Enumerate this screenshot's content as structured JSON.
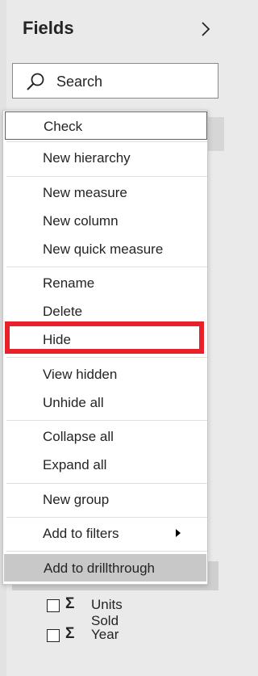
{
  "pane": {
    "title": "Fields",
    "collapse_icon": "chevron-right-icon",
    "search_placeholder": "Search",
    "search_icon": "search-icon"
  },
  "fields": [
    {
      "label": "Units Sold",
      "icon": "sigma-icon",
      "checked": false
    },
    {
      "label": "Year",
      "icon": "sigma-icon",
      "checked": false
    }
  ],
  "context_menu": {
    "items": [
      {
        "label": "Check"
      },
      {
        "label": "New hierarchy"
      },
      {
        "label": "New measure"
      },
      {
        "label": "New column"
      },
      {
        "label": "New quick measure"
      },
      {
        "label": "Rename"
      },
      {
        "label": "Delete"
      },
      {
        "label": "Hide"
      },
      {
        "label": "View hidden"
      },
      {
        "label": "Unhide all"
      },
      {
        "label": "Collapse all"
      },
      {
        "label": "Expand all"
      },
      {
        "label": "New group"
      },
      {
        "label": "Add to filters",
        "submenu": true
      },
      {
        "label": "Add to drillthrough"
      }
    ],
    "highlighted_item": "Hide",
    "highlight_color": "#e8202a"
  }
}
